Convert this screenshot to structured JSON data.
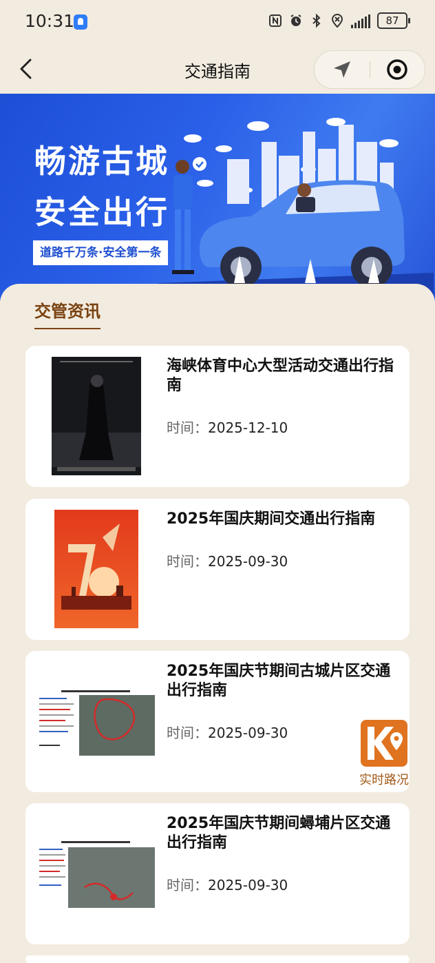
{
  "status_bar": {
    "time": "10:31",
    "battery": "87"
  },
  "nav": {
    "title": "交通指南"
  },
  "banner": {
    "line1": "畅游古城",
    "line2": "安全出行",
    "slogan": "道路千万条·安全第一条"
  },
  "section": {
    "title": "交管资讯"
  },
  "articles": [
    {
      "title": "海峡体育中心大型活动交通出行指南",
      "time_label": "时间：",
      "date": "2025-12-10"
    },
    {
      "title": "2025年国庆期间交通出行指南",
      "time_label": "时间：",
      "date": "2025-09-30"
    },
    {
      "title": "2025年国庆节期间古城片区交通出行指南",
      "time_label": "时间：",
      "date": "2025-09-30"
    },
    {
      "title": "2025年国庆节期间蟳埔片区交通出行指南",
      "time_label": "时间：",
      "date": "2025-09-30"
    }
  ],
  "floating": {
    "live_traffic_label": "实时路况"
  },
  "colors": {
    "accent_brown": "#7a4210",
    "banner_blue": "#2a5fe8",
    "live_orange": "#e0731f",
    "background": "#f2ebdf"
  }
}
